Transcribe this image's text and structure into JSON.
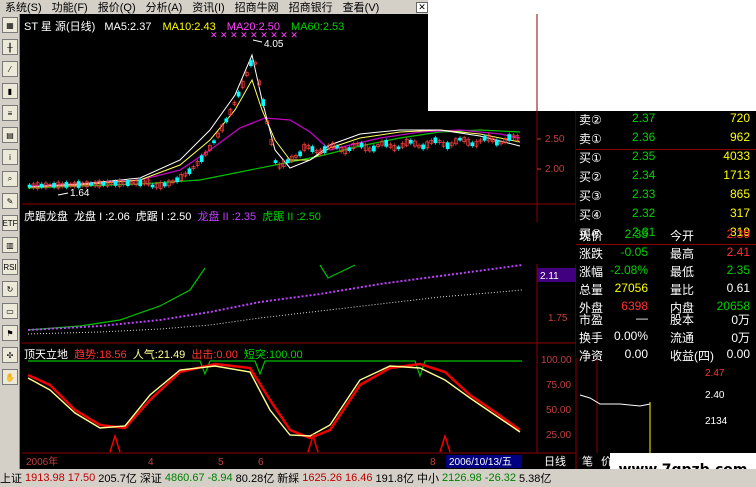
{
  "menu": {
    "items": [
      "系统(S)",
      "功能(F)",
      "报价(Q)",
      "分析(A)",
      "资讯(I)",
      "招商牛网",
      "招商银行",
      "查看(V)"
    ],
    "close": "✕"
  },
  "toolbar_icons": [
    "chart-icon",
    "kline-icon",
    "line-icon",
    "bar-icon",
    "list-icon",
    "grid-icon",
    "info-icon",
    "search-icon",
    "tools-icon",
    "etf-icon",
    "table-icon",
    "rsi-icon",
    "refresh-icon",
    "doc-icon",
    "flag-icon",
    "pin-icon",
    "hand-icon"
  ],
  "toolbar_labels": {
    "etf": "ETF",
    "rsi": "RSI"
  },
  "main_chart": {
    "title": "ST 星 源(日线)",
    "ma5": "MA5:2.37",
    "ma10": "MA10:2.43",
    "ma20": "MA20:2.50",
    "ma60": "MA60:2.53",
    "high_label": "4.05",
    "low_label": "1.64",
    "y_ticks": [
      "2.50",
      "2.00"
    ]
  },
  "indicator1": {
    "name": "虎踞龙盘",
    "l1": "龙盘 I :2.06",
    "l2": "虎踞 I :2.50",
    "l3": "龙盘 II :2.35",
    "l4": "虎踞 II :2.50",
    "y_ticks": [
      "2.11",
      "1.75"
    ]
  },
  "indicator2": {
    "name": "顶天立地",
    "trend": "趋势:18.56",
    "popularity": "人气:21.49",
    "out": "出击:0.00",
    "short": "短突:100.00",
    "y_ticks": [
      "100.00",
      "75.00",
      "50.00",
      "25.00"
    ]
  },
  "xaxis": {
    "year": "2006年",
    "marks": [
      "4",
      "5",
      "6",
      "8"
    ],
    "date": "2006/10/13/五",
    "period": "日线"
  },
  "order_book": [
    {
      "label": "卖②",
      "price": "2.37",
      "vol": "720"
    },
    {
      "label": "卖①",
      "price": "2.36",
      "vol": "962"
    },
    {
      "label": "买①",
      "price": "2.35",
      "vol": "4033"
    },
    {
      "label": "买②",
      "price": "2.34",
      "vol": "1713"
    },
    {
      "label": "买③",
      "price": "2.33",
      "vol": "865"
    },
    {
      "label": "买④",
      "price": "2.32",
      "vol": "317"
    },
    {
      "label": "买⑤",
      "price": "2.31",
      "vol": "319"
    }
  ],
  "quote": [
    {
      "k1": "现价",
      "v1": "2.35",
      "k2": "今开",
      "v2": "2.39"
    },
    {
      "k1": "涨跌",
      "v1": "-0.05",
      "k2": "最高",
      "v2": "2.41"
    },
    {
      "k1": "涨幅",
      "v1": "-2.08%",
      "k2": "最低",
      "v2": "2.35"
    },
    {
      "k1": "总量",
      "v1": "27056",
      "k2": "量比",
      "v2": "0.61"
    },
    {
      "k1": "外盘",
      "v1": "6398",
      "k2": "内盘",
      "v2": "20658"
    },
    {
      "k1": "市盈",
      "v1": "—",
      "k2": "股本",
      "v2": "0万"
    },
    {
      "k1": "换手",
      "v1": "0.00%",
      "k2": "流通",
      "v2": "0万"
    },
    {
      "k1": "净资",
      "v1": "0.00",
      "k2": "收益(四)",
      "v2": "0.00"
    }
  ],
  "mini_chart": {
    "p1": "2.47",
    "p2": "2.40",
    "p3": "2134"
  },
  "tabs": [
    "笔",
    "价"
  ],
  "status": {
    "sh_label": "上证",
    "sh_val": "1913.98",
    "sh_chg": "17.50",
    "sh_amt": "205.7亿",
    "sz_label": "深证",
    "sz_val": "4860.67",
    "sz_chg": "-8.94",
    "sz_amt": "80.28亿",
    "nb_label": "新綵",
    "nb_val": "1625.26",
    "nb_chg": "16.46",
    "nb_amt": "191.8亿",
    "zx_label": "中小",
    "zx_val": "2126.98",
    "zx_chg": "-26.32",
    "zx_amt": "5.38亿"
  },
  "watermark": "www.7gpzb.com",
  "colors": {
    "up": "#ff3232",
    "down": "#00d000",
    "ma5": "#ffffff",
    "ma10": "#ffff00",
    "ma20": "#ff00ff",
    "ma60": "#00ff00",
    "trend": "#ff0000",
    "pop": "#ffff80"
  }
}
